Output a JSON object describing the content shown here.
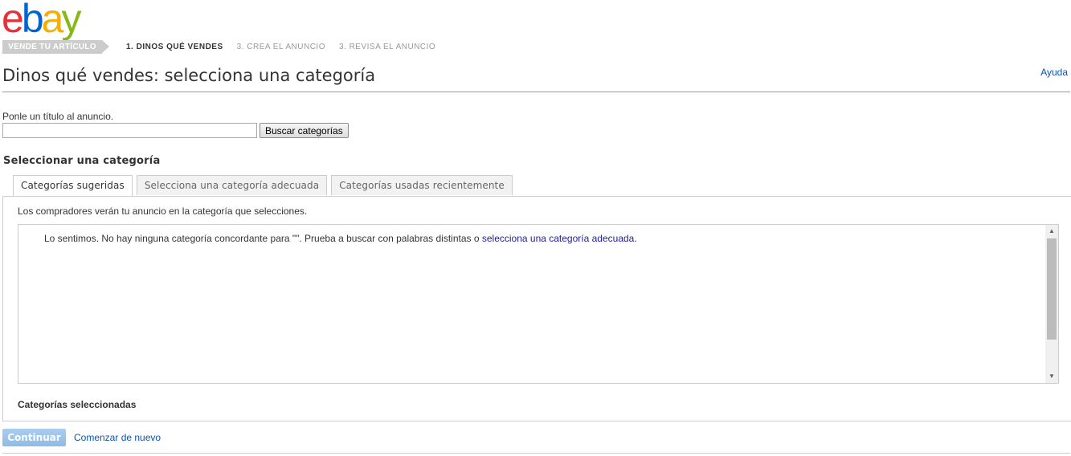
{
  "brand": {
    "letters": [
      "e",
      "b",
      "a",
      "y"
    ],
    "colors": [
      "#e53238",
      "#0064d2",
      "#f5af02",
      "#86b817"
    ]
  },
  "steps": {
    "current_section": "VENDE TU ARTÍCULO",
    "items": [
      "1. DINOS QUÉ VENDES",
      "3. CREA EL ANUNCIO",
      "3. REVISA EL ANUNCIO"
    ]
  },
  "header": {
    "title": "Dinos qué vendes: selecciona una categoría",
    "help": "Ayuda"
  },
  "search": {
    "label": "Ponle un título al anuncio.",
    "value": "",
    "button": "Buscar categorías"
  },
  "category": {
    "section_title": "Seleccionar una categoría",
    "tabs": [
      "Categorías sugeridas",
      "Selecciona una categoría adecuada",
      "Categorías usadas recientemente"
    ],
    "active_tab": 0,
    "note": "Los compradores verán tu anuncio en la categoría que selecciones.",
    "message_prefix": "Lo sentimos. No hay ninguna categoría concordante para \"\". Prueba a buscar con palabras distintas o ",
    "message_link": "selecciona una categoría adecuada",
    "message_suffix": ".",
    "selected_title": "Categorías seleccionadas"
  },
  "footer": {
    "continue": "Continuar",
    "restart": "Comenzar de nuevo"
  },
  "colors": {
    "link": "#0654ba",
    "continue_button": "#9ec6ee"
  },
  "icons": {
    "scroll_up": "triangle-up",
    "scroll_down": "triangle-down"
  }
}
